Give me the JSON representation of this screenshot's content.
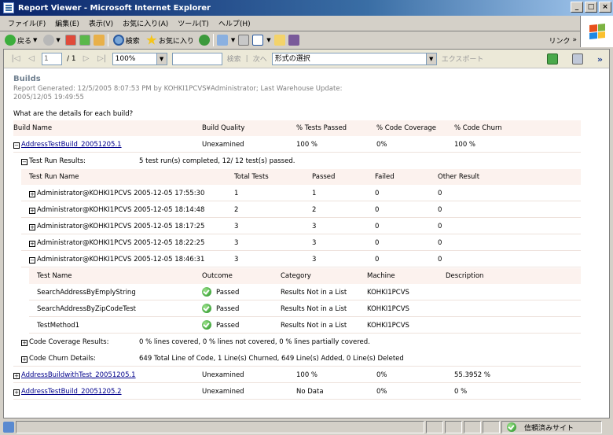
{
  "window": {
    "title": "Report Viewer - Microsoft Internet Explorer",
    "minimize": "_",
    "maximize": "□",
    "close": "×"
  },
  "menu": [
    "ファイル(F)",
    "編集(E)",
    "表示(V)",
    "お気に入り(A)",
    "ツール(T)",
    "ヘルプ(H)"
  ],
  "toolbar": {
    "back": "戻る",
    "search": "検索",
    "favorites": "お気に入り",
    "links": "リンク"
  },
  "report_toolbar": {
    "first": "|◁",
    "prev": "◁",
    "page": "1",
    "of_pages": "/ 1",
    "next": "▷",
    "last": "▷|",
    "zoom": "100%",
    "find": "検索",
    "find_sep": "|",
    "find_next": "次へ",
    "format": "形式の選択",
    "export": "エクスポート",
    "expand": "»"
  },
  "report": {
    "title": "Builds",
    "generated": "Report Generated: 12/5/2005 8:07:53 PM by KOHKI1PCVS¥Administrator; Last Warehouse Update: 2005/12/05 19:49:55",
    "question": "What are the details for each build?",
    "build_headers": [
      "Build Name",
      "Build Quality",
      "% Tests Passed",
      "% Code Coverage",
      "% Code Churn"
    ],
    "builds": [
      {
        "name": "AddressTestBuild_20051205.1",
        "quality": "Unexamined",
        "tests_passed": "100 %",
        "coverage": "0%",
        "churn": "100 %"
      },
      {
        "name": "AddressBuildwithTest_20051205.1",
        "quality": "Unexamined",
        "tests_passed": "100 %",
        "coverage": "0%",
        "churn": "55.3952 %"
      },
      {
        "name": "AddressTestBuild_20051205.2",
        "quality": "Unexamined",
        "tests_passed": "No Data",
        "coverage": "0%",
        "churn": "0 %"
      }
    ],
    "test_run_results_label": "Test Run Results:",
    "test_run_results_summary": "5 test run(s) completed, 12/ 12 test(s) passed.",
    "run_headers": [
      "Test Run Name",
      "Total Tests",
      "Passed",
      "Failed",
      "Other Result"
    ],
    "runs": [
      {
        "name": "Administrator@KOHKI1PCVS 2005-12-05 17:55:30",
        "total": "1",
        "passed": "1",
        "failed": "0",
        "other": "0"
      },
      {
        "name": "Administrator@KOHKI1PCVS 2005-12-05 18:14:48",
        "total": "2",
        "passed": "2",
        "failed": "0",
        "other": "0"
      },
      {
        "name": "Administrator@KOHKI1PCVS 2005-12-05 18:17:25",
        "total": "3",
        "passed": "3",
        "failed": "0",
        "other": "0"
      },
      {
        "name": "Administrator@KOHKI1PCVS 2005-12-05 18:22:25",
        "total": "3",
        "passed": "3",
        "failed": "0",
        "other": "0"
      },
      {
        "name": "Administrator@KOHKI1PCVS 2005-12-05 18:46:31",
        "total": "3",
        "passed": "3",
        "failed": "0",
        "other": "0"
      }
    ],
    "test_headers": [
      "Test Name",
      "Outcome",
      "Category",
      "Machine",
      "Description"
    ],
    "tests": [
      {
        "name": "SearchAddressByEmplyString",
        "outcome": "Passed",
        "category": "Results Not in a List",
        "machine": "KOHKI1PCVS"
      },
      {
        "name": "SearchAddressByZipCodeTest",
        "outcome": "Passed",
        "category": "Results Not in a List",
        "machine": "KOHKI1PCVS"
      },
      {
        "name": "TestMethod1",
        "outcome": "Passed",
        "category": "Results Not in a List",
        "machine": "KOHKI1PCVS"
      }
    ],
    "coverage_label": "Code Coverage Results:",
    "coverage_summary": "0 % lines covered, 0 % lines not covered, 0 % lines partially covered.",
    "churn_label": "Code Churn Details:",
    "churn_summary": "649 Total Line of Code, 1 Line(s) Churned, 649 Line(s) Added, 0 Line(s) Deleted"
  },
  "status": {
    "zone": "信頼済みサイト"
  },
  "colors": {
    "title_gradient_start": "#0a246a",
    "header_row_bg": "#fcf2ee",
    "link": "#00008b"
  }
}
